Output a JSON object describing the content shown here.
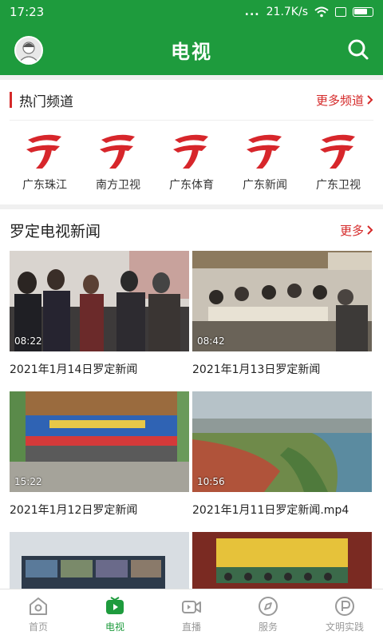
{
  "status_bar": {
    "time": "17:23",
    "dots": "...",
    "speed": "21.7K/s"
  },
  "app_bar": {
    "title": "电视"
  },
  "hot_channels": {
    "title": "热门频道",
    "more": "更多频道",
    "items": [
      {
        "name": "广东珠江"
      },
      {
        "name": "南方卫视"
      },
      {
        "name": "广东体育"
      },
      {
        "name": "广东新闻"
      },
      {
        "name": "广东卫视"
      }
    ]
  },
  "news": {
    "title": "罗定电视新闻",
    "more": "更多",
    "items": [
      {
        "title": "2021年1月14日罗定新闻",
        "duration": "08:22"
      },
      {
        "title": "2021年1月13日罗定新闻",
        "duration": "08:42"
      },
      {
        "title": "2021年1月12日罗定新闻",
        "duration": "15:22"
      },
      {
        "title": "2021年1月11日罗定新闻.mp4",
        "duration": "10:56"
      },
      {
        "title": "",
        "duration": ""
      },
      {
        "title": "",
        "duration": ""
      }
    ]
  },
  "tab_bar": {
    "items": [
      {
        "label": "首页",
        "icon": "home-icon"
      },
      {
        "label": "电视",
        "icon": "tv-play-icon"
      },
      {
        "label": "直播",
        "icon": "live-camera-icon"
      },
      {
        "label": "服务",
        "icon": "compass-icon"
      },
      {
        "label": "文明实践",
        "icon": "civilization-icon"
      }
    ],
    "active_index": 1
  },
  "colors": {
    "brand_green": "#1e9b3d",
    "accent_red": "#d52a2a"
  }
}
